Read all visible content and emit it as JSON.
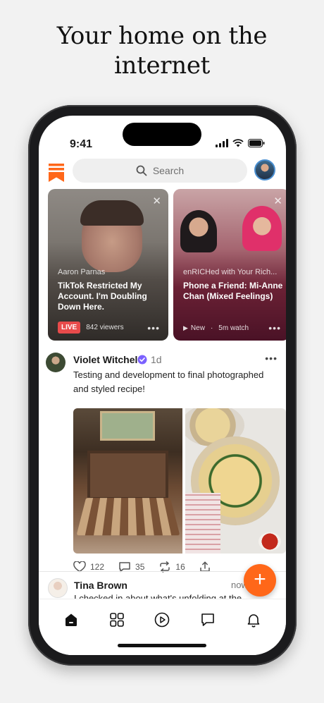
{
  "headline": {
    "line1": "Your home on the",
    "line2": "internet"
  },
  "status_bar": {
    "time": "9:41"
  },
  "search": {
    "placeholder": "Search"
  },
  "stories": [
    {
      "author": "Aaron Parnas",
      "title": "TikTok Restricted My Account. I'm Doubling Down Here.",
      "badge": "LIVE",
      "meta": "842 viewers"
    },
    {
      "author": "enRICHed with Your Rich...",
      "title": "Phone a Friend: Mi-Anne Chan (Mixed Feelings)",
      "badge": "New",
      "meta": "5m watch"
    }
  ],
  "post": {
    "author": "Violet Witchel",
    "age": "1d",
    "text": "Testing and development to final photographed and styled recipe!",
    "likes": "122",
    "comments": "35",
    "restacks": "16"
  },
  "post2": {
    "author": "Tina Brown",
    "age": "now",
    "text": "I checked in about what's unfolding at the"
  },
  "colors": {
    "accent": "#ff6719",
    "live": "#e84b4b",
    "verified": "#7b61ff"
  },
  "icons": {
    "tabs": [
      "home-icon",
      "grid-icon",
      "play-icon",
      "chat-icon",
      "bell-icon"
    ]
  }
}
